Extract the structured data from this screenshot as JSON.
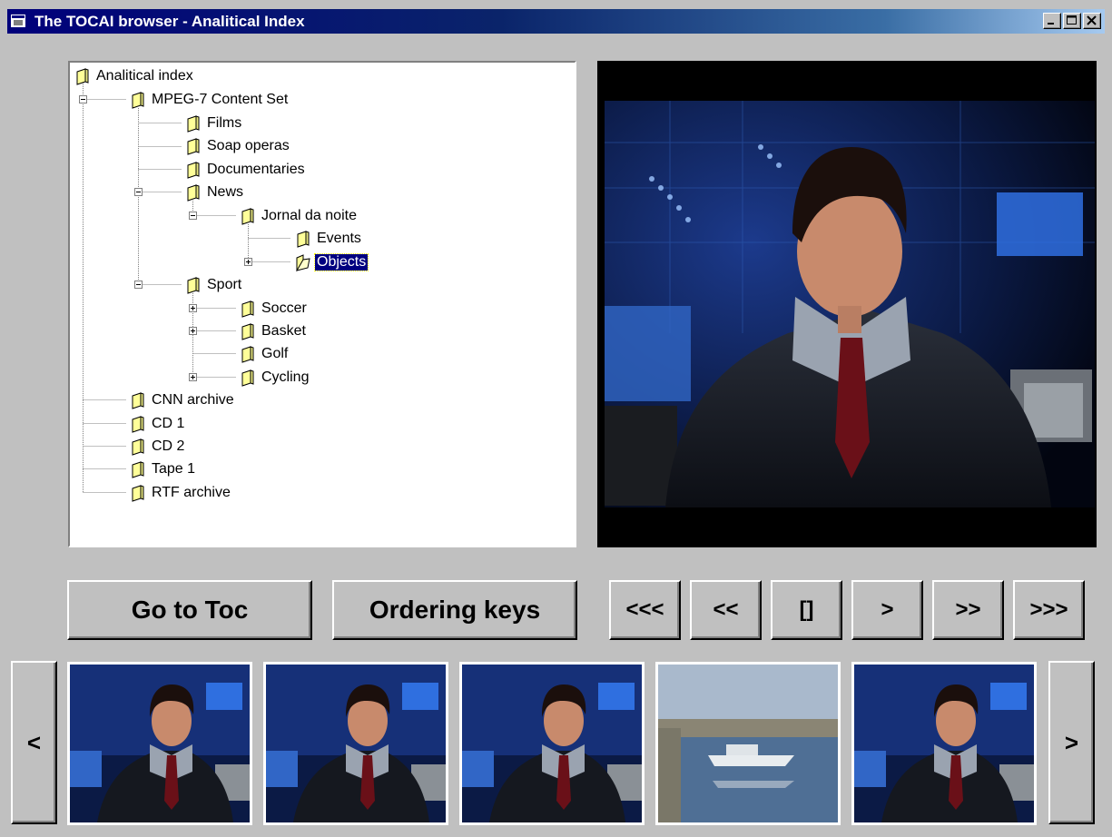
{
  "window": {
    "title": "The TOCAI browser - Analitical Index",
    "minimize_icon": "minimize-icon",
    "maximize_icon": "maximize-icon",
    "close_icon": "close-icon"
  },
  "tree": {
    "root": "Analitical index",
    "nodes": [
      {
        "label": "MPEG-7 Content Set",
        "expander": "minus"
      },
      {
        "label": "Films"
      },
      {
        "label": "Soap operas"
      },
      {
        "label": "Documentaries"
      },
      {
        "label": "News",
        "expander": "minus"
      },
      {
        "label": "Jornal da noite",
        "expander": "minus"
      },
      {
        "label": "Events"
      },
      {
        "label": "Objects",
        "expander": "plus",
        "selected": true
      },
      {
        "label": "Sport",
        "expander": "minus"
      },
      {
        "label": "Soccer",
        "expander": "plus"
      },
      {
        "label": "Basket",
        "expander": "plus"
      },
      {
        "label": "Golf"
      },
      {
        "label": "Cycling",
        "expander": "plus"
      },
      {
        "label": "CNN archive"
      },
      {
        "label": "CD 1"
      },
      {
        "label": "CD 2"
      },
      {
        "label": "Tape 1"
      },
      {
        "label": "RTF archive"
      }
    ]
  },
  "buttons": {
    "go_to_toc": "Go to Toc",
    "ordering_keys": "Ordering keys",
    "rewind_fast": "<<<",
    "rewind": "<<",
    "stop": "[]",
    "play": ">",
    "forward": ">>",
    "forward_fast": ">>>"
  },
  "filmstrip": {
    "prev": "<",
    "next": ">",
    "thumbnails": [
      "anchor",
      "anchor",
      "anchor",
      "boats",
      "anchor"
    ]
  },
  "colors": {
    "selection": "#000080",
    "face": "#c0c0c0",
    "title_gradient_start": "#00007b"
  }
}
